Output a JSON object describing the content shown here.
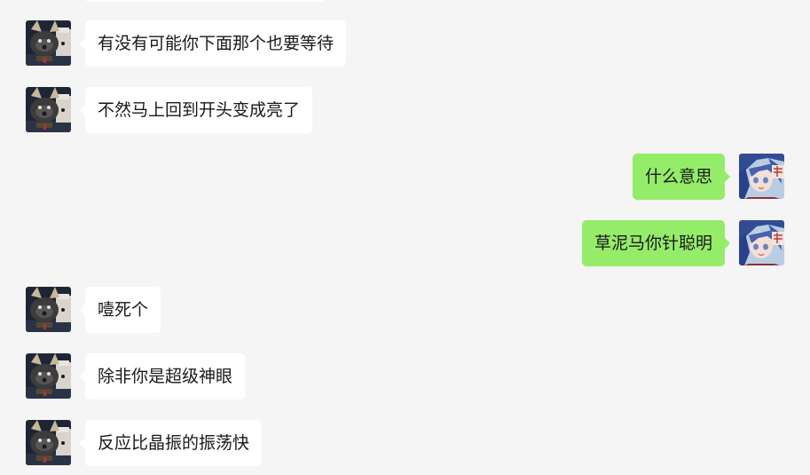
{
  "chat": {
    "messages": [
      {
        "side": "left",
        "text": "有没有可能你下面那个也要等待",
        "avatar_icon": "cat-avatar-icon"
      },
      {
        "side": "left",
        "text": "不然马上回到开头变成亮了",
        "avatar_icon": "cat-avatar-icon"
      },
      {
        "side": "right",
        "text": "什么意思",
        "avatar_icon": "anime-girl-avatar-icon"
      },
      {
        "side": "right",
        "text": "草泥马你针聪明",
        "avatar_icon": "anime-girl-avatar-icon"
      },
      {
        "side": "left",
        "text": "噎死个",
        "avatar_icon": "cat-avatar-icon"
      },
      {
        "side": "left",
        "text": "除非你是超级神眼",
        "avatar_icon": "cat-avatar-icon"
      },
      {
        "side": "left",
        "text": "反应比晶振的振荡快",
        "avatar_icon": "cat-avatar-icon"
      }
    ]
  },
  "colors": {
    "background": "#f5f5f5",
    "incoming_bubble": "#ffffff",
    "outgoing_bubble": "#95ec69",
    "text": "#191919"
  }
}
